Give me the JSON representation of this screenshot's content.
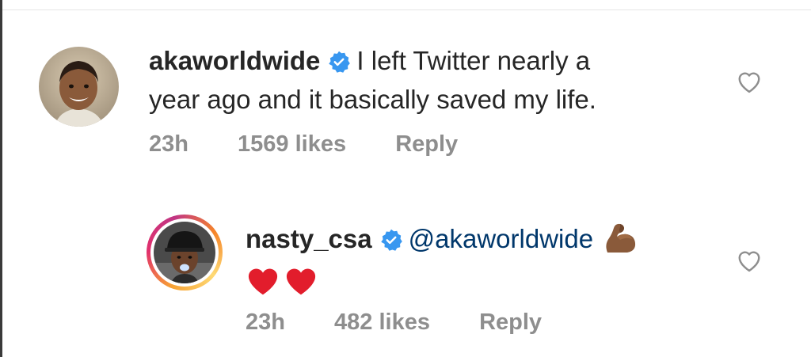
{
  "comments": [
    {
      "username": "akaworldwide",
      "text_line1": "I left Twitter nearly a",
      "text_line2": "year ago and it basically saved my life.",
      "time": "23h",
      "likes": "1569 likes",
      "reply": "Reply",
      "verified": true,
      "avatar": "boy-smiling-photo"
    },
    {
      "username": "nasty_csa",
      "mention": "@akaworldwide",
      "emoji_1": "flexed-biceps-emoji",
      "emoji_2": "red-heart-emoji x2",
      "time": "23h",
      "likes": "482 likes",
      "reply": "Reply",
      "verified": true,
      "has_story_ring": true,
      "avatar": "man-with-cap-photo"
    }
  ],
  "colors": {
    "verified": "#3897f0",
    "mention": "#00376b",
    "meta_gray": "#8e8e8e",
    "heart_red": "#e21d2c"
  }
}
